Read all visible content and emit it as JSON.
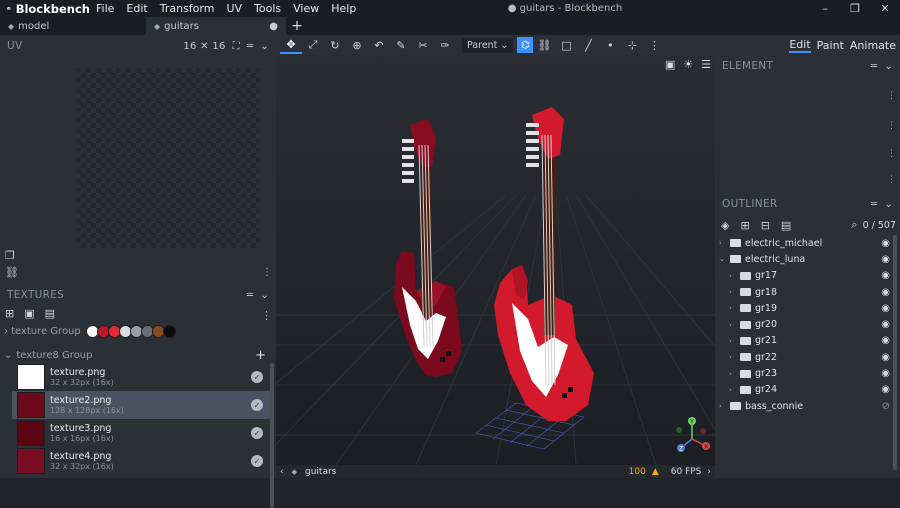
{
  "app": {
    "name": "Blockbench",
    "window_title": "● guitars - Blockbench"
  },
  "menu": [
    "File",
    "Edit",
    "Transform",
    "UV",
    "Tools",
    "View",
    "Help"
  ],
  "window_controls": {
    "minimize": "–",
    "restore": "❐",
    "close": "✕"
  },
  "tabs": [
    {
      "label": "model"
    },
    {
      "label": "guitars",
      "modified": "●"
    }
  ],
  "tab_add": "+",
  "uv_panel": {
    "title": "UV",
    "size": "16 ✕ 16"
  },
  "textures_panel": {
    "title": "TEXTURES",
    "group1": {
      "label": "texture Group",
      "swatches": [
        "#ffffff",
        "#c0172a",
        "#e22d3a",
        "#d9dce1",
        "#9aa0a8",
        "#6a6f78",
        "#8a4a20",
        "#0c0c0c"
      ]
    },
    "group2": {
      "label": "texture8 Group"
    },
    "items": [
      {
        "name": "texture.png",
        "size": "32 x 32px (16x)",
        "color": "#ffffff"
      },
      {
        "name": "texture2.png",
        "size": "128 x 128px (16x)",
        "color": "#6a0a1a"
      },
      {
        "name": "texture3.png",
        "size": "16 x 16px (16x)",
        "color": "#5a0612"
      },
      {
        "name": "texture4.png",
        "size": "32 x 32px (16x)",
        "color": "#7a0c22"
      }
    ]
  },
  "toolbar": {
    "pivot_mode": "Parent"
  },
  "status": {
    "model_name": "guitars",
    "warnings": "100",
    "fps": "60 FPS"
  },
  "modes": {
    "edit": "Edit",
    "paint": "Paint",
    "animate": "Animate"
  },
  "element_panel": {
    "title": "ELEMENT"
  },
  "outliner": {
    "title": "OUTLINER",
    "count": "0 / 507",
    "nodes": [
      {
        "label": "electric_michael",
        "level": 0,
        "open": false,
        "visible": true
      },
      {
        "label": "electric_luna",
        "level": 0,
        "open": true,
        "visible": true
      },
      {
        "label": "gr17",
        "level": 1,
        "open": false,
        "visible": true
      },
      {
        "label": "gr18",
        "level": 1,
        "open": false,
        "visible": true
      },
      {
        "label": "gr19",
        "level": 1,
        "open": false,
        "visible": true
      },
      {
        "label": "gr20",
        "level": 1,
        "open": false,
        "visible": true
      },
      {
        "label": "gr21",
        "level": 1,
        "open": false,
        "visible": true
      },
      {
        "label": "gr22",
        "level": 1,
        "open": false,
        "visible": true
      },
      {
        "label": "gr23",
        "level": 1,
        "open": false,
        "visible": true
      },
      {
        "label": "gr24",
        "level": 1,
        "open": false,
        "visible": true
      },
      {
        "label": "bass_connie",
        "level": 0,
        "open": false,
        "visible": false
      }
    ]
  },
  "gizmo": {
    "x": "X",
    "y": "Y",
    "z": "Z"
  }
}
